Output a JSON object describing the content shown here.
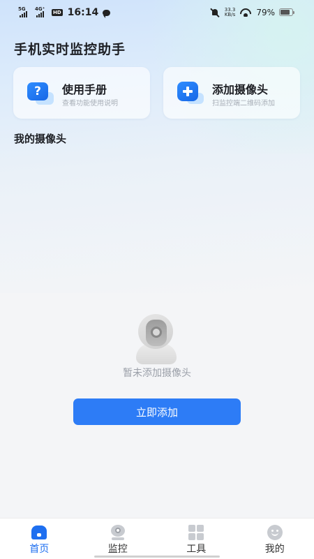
{
  "status_bar": {
    "network_1": "5G",
    "network_2": "4G⁺",
    "hd_badge": "HD",
    "time": "16:14",
    "speed_value": "33.3",
    "speed_unit": "KB/s",
    "battery_percent": "79%",
    "battery_level": 0.79
  },
  "header": {
    "app_title": "手机实时监控助手"
  },
  "cards": {
    "manual": {
      "title": "使用手册",
      "subtitle": "查看功能使用说明",
      "icon": "question-icon"
    },
    "add_camera": {
      "title": "添加摄像头",
      "subtitle": "扫监控端二维码添加",
      "icon": "plus-icon"
    }
  },
  "section": {
    "my_cameras_title": "我的摄像头"
  },
  "empty_state": {
    "icon": "camera-icon",
    "message": "暂未添加摄像头",
    "button_label": "立即添加"
  },
  "tab_bar": {
    "active": "home",
    "tabs": [
      {
        "id": "home",
        "label": "首页",
        "icon": "home-icon"
      },
      {
        "id": "monitor",
        "label": "监控",
        "icon": "monitor-icon"
      },
      {
        "id": "tools",
        "label": "工具",
        "icon": "tools-icon"
      },
      {
        "id": "mine",
        "label": "我的",
        "icon": "profile-icon"
      }
    ]
  },
  "colors": {
    "accent": "#2d7cf6",
    "active_tab": "#1e6ff0",
    "inactive_icon": "#c8cbd0",
    "hint_text": "#9a9fa8"
  }
}
